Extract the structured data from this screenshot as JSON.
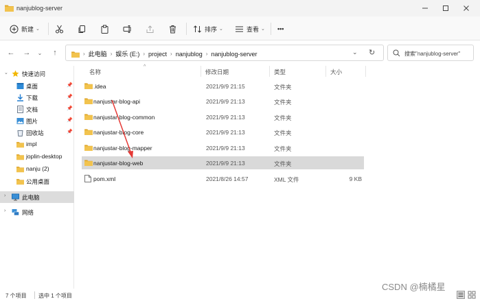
{
  "window": {
    "title": "nanjublog-server"
  },
  "titlebar_buttons": [
    "minimize",
    "maximize",
    "close"
  ],
  "toolbar": {
    "new_label": "新建",
    "sort_label": "排序",
    "view_label": "查看",
    "more_label": "•••"
  },
  "address": {
    "crumbs": [
      "此电脑",
      "娱乐 (E:)",
      "project",
      "nanjublog",
      "nanjublog-server"
    ]
  },
  "search": {
    "placeholder": "搜索\"nanjublog-server\""
  },
  "nav": {
    "quick_access": "快速访问",
    "pinned": [
      {
        "label": "桌面",
        "icon": "desktop-icon",
        "pinned": true
      },
      {
        "label": "下载",
        "icon": "download-icon",
        "pinned": true
      },
      {
        "label": "文档",
        "icon": "document-icon",
        "pinned": true
      },
      {
        "label": "图片",
        "icon": "picture-icon",
        "pinned": true
      },
      {
        "label": "回收站",
        "icon": "recycle-bin-icon",
        "pinned": true
      },
      {
        "label": "impl",
        "icon": "folder-icon"
      },
      {
        "label": "joplin-desktop",
        "icon": "folder-icon"
      },
      {
        "label": "nanju (2)",
        "icon": "folder-icon"
      },
      {
        "label": "公用桌面",
        "icon": "folder-icon"
      }
    ],
    "this_pc": "此电脑",
    "network": "网络"
  },
  "columns": {
    "name": "名称",
    "date": "修改日期",
    "type": "类型",
    "size": "大小"
  },
  "files": [
    {
      "name": ".idea",
      "date": "2021/9/9 21:15",
      "type": "文件夹",
      "size": "",
      "kind": "folder"
    },
    {
      "name": "nanjustar-blog-api",
      "date": "2021/9/9 21:13",
      "type": "文件夹",
      "size": "",
      "kind": "folder"
    },
    {
      "name": "nanjustar-blog-common",
      "date": "2021/9/9 21:13",
      "type": "文件夹",
      "size": "",
      "kind": "folder"
    },
    {
      "name": "nanjustar-blog-core",
      "date": "2021/9/9 21:13",
      "type": "文件夹",
      "size": "",
      "kind": "folder"
    },
    {
      "name": "nanjustar-blog-mapper",
      "date": "2021/9/9 21:13",
      "type": "文件夹",
      "size": "",
      "kind": "folder"
    },
    {
      "name": "nanjustar-blog-web",
      "date": "2021/9/9 21:13",
      "type": "文件夹",
      "size": "",
      "kind": "folder",
      "selected": true
    },
    {
      "name": "pom.xml",
      "date": "2021/8/26 14:57",
      "type": "XML 文件",
      "size": "9 KB",
      "kind": "file"
    }
  ],
  "status": {
    "count": "7 个项目",
    "selection": "选中 1 个项目"
  },
  "watermark": "CSDN @楠橘星",
  "colors": {
    "folder": "#f2c34e",
    "folder_dark": "#e0a82e",
    "selection": "#d9d9d9",
    "annotation_arrow": "#e53935",
    "accent": "#1a73c8"
  }
}
